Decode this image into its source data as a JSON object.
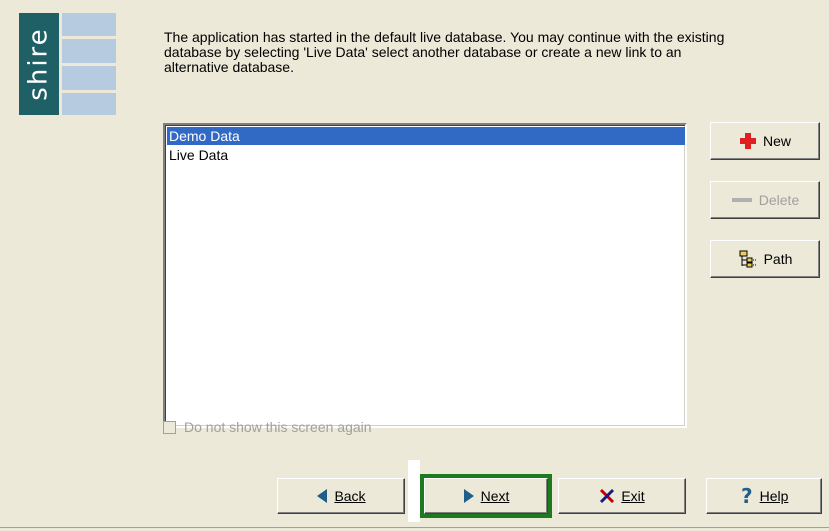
{
  "logo": {
    "text": "shire"
  },
  "intro": {
    "text": "The application has started in the default live database. You may continue with the existing database by selecting 'Live Data' select another database or create a new link to an alternative database."
  },
  "database_list": {
    "items": [
      {
        "label": "Demo Data",
        "selected": true
      },
      {
        "label": "Live Data",
        "selected": false
      }
    ]
  },
  "side_buttons": {
    "new_label": "New",
    "delete_label": "Delete",
    "path_label": "Path"
  },
  "checkbox": {
    "label": "Do not show this screen again",
    "checked": false,
    "enabled": false
  },
  "nav_buttons": {
    "back_label": "Back",
    "next_label": "Next",
    "exit_label": "Exit",
    "help_label": "Help"
  },
  "icons": {
    "new": "plus-icon",
    "delete": "minus-icon",
    "path": "folder-tree-icon",
    "back": "triangle-left-icon",
    "next": "triangle-right-icon",
    "exit": "x-icon",
    "help": "question-icon"
  },
  "colors": {
    "selection": "#316ac5",
    "logo_dark": "#1f5f66",
    "logo_bars": "#b7cbe0",
    "highlight": "#1e7a1e",
    "new_icon": "#e02020",
    "nav_arrow": "#1f5f8a"
  }
}
